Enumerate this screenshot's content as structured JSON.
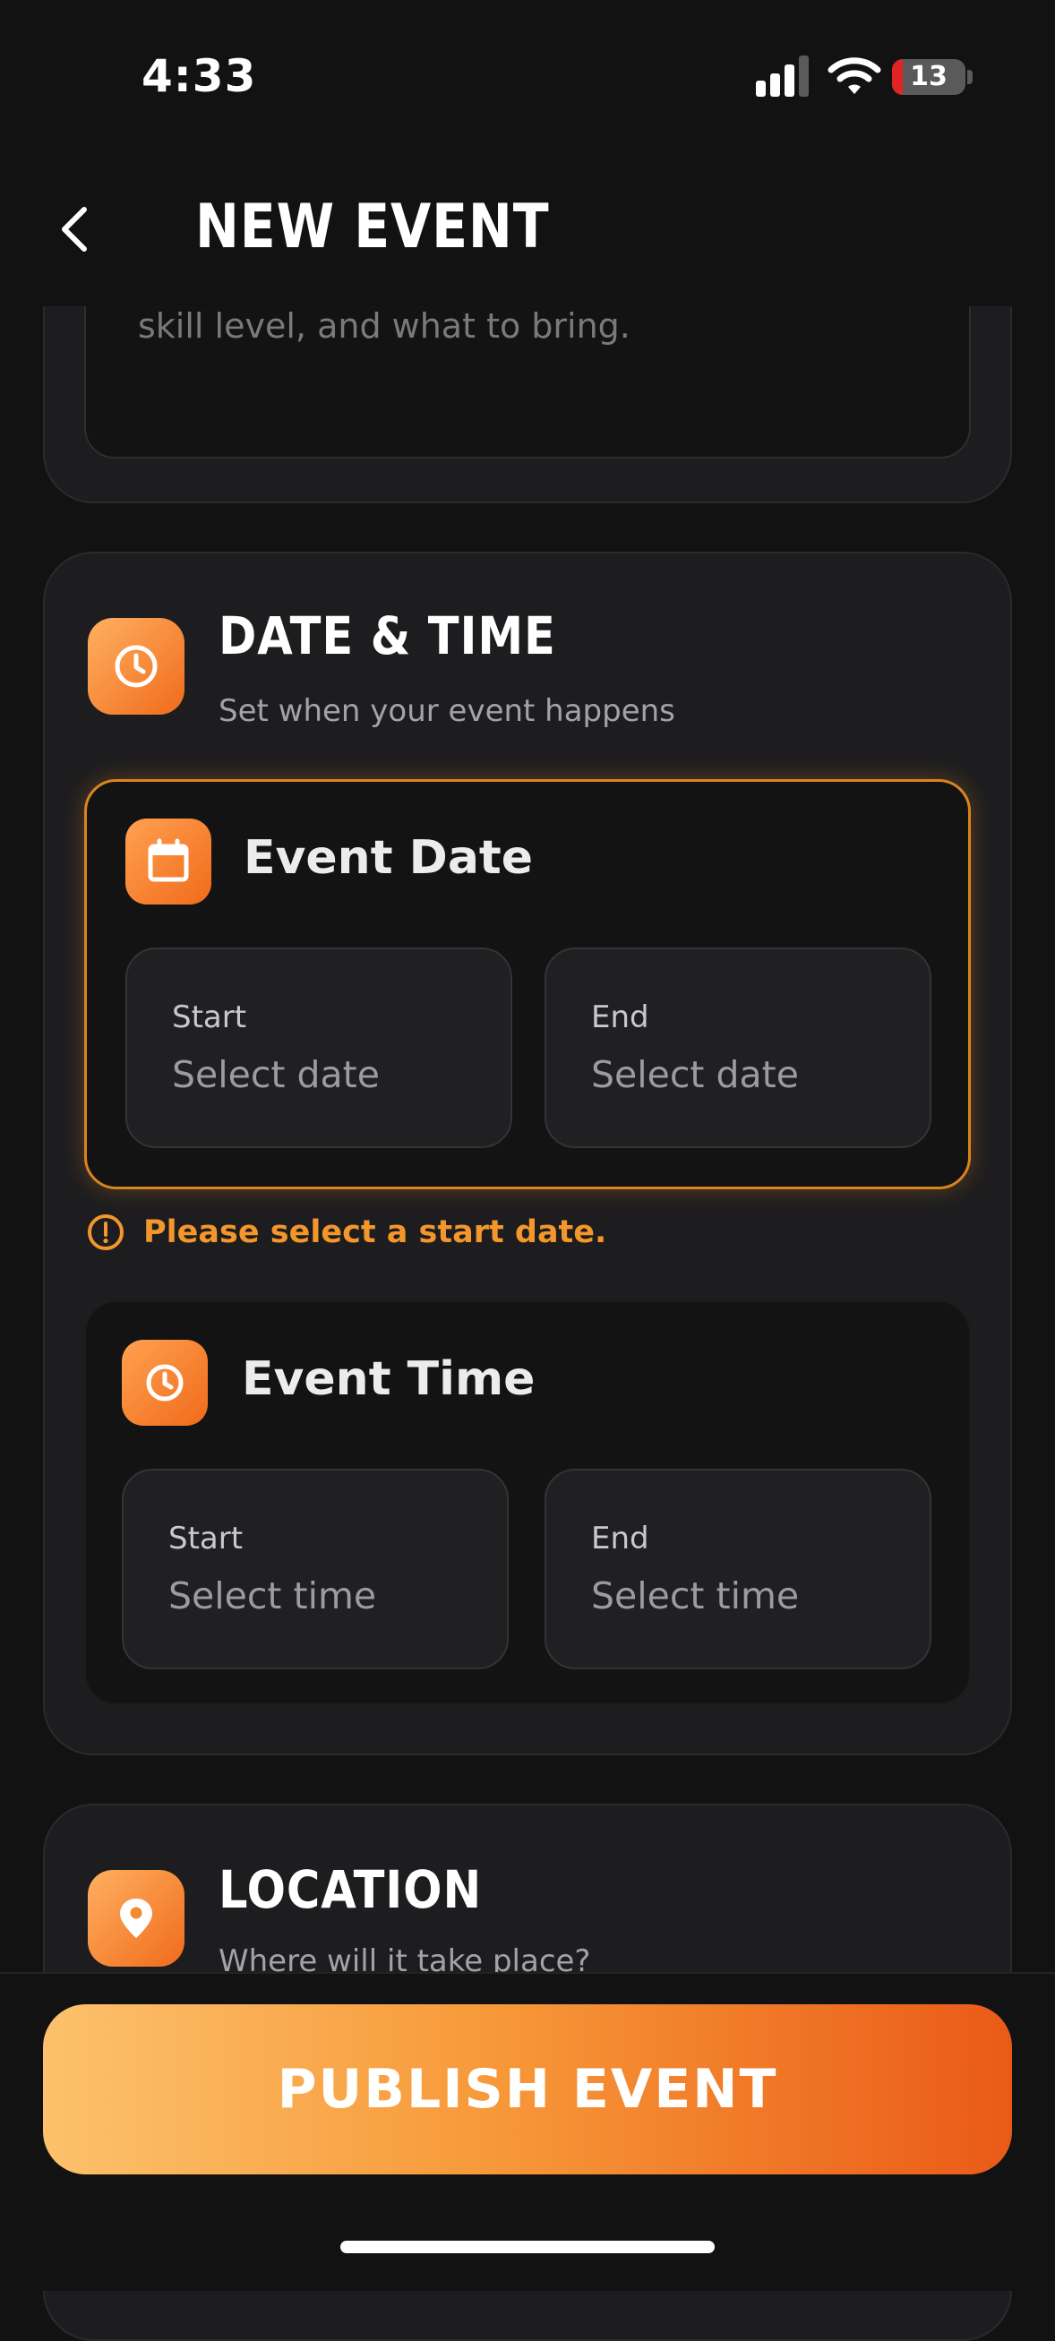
{
  "status_bar": {
    "time": "4:33",
    "battery": "13"
  },
  "header": {
    "title": "NEW EVENT"
  },
  "description": {
    "placeholder_tail": "skill level, and what to bring."
  },
  "date_time": {
    "title": "DATE & TIME",
    "subtitle": "Set when your event happens",
    "event_date": {
      "title": "Event Date",
      "start_label": "Start",
      "start_value": "Select date",
      "end_label": "End",
      "end_value": "Select date"
    },
    "error": "Please select a start date.",
    "event_time": {
      "title": "Event Time",
      "start_label": "Start",
      "start_value": "Select time",
      "end_label": "End",
      "end_value": "Select time"
    }
  },
  "location": {
    "title": "LOCATION",
    "subtitle": "Where will it take place?"
  },
  "actions": {
    "publish_label": "PUBLISH EVENT"
  },
  "colors": {
    "accent": "#f5882a",
    "error": "#f3962b",
    "background": "#121212",
    "card": "#1d1d1f"
  },
  "icons": [
    "back-icon",
    "clock-icon",
    "calendar-icon",
    "alert-icon",
    "location-pin-icon"
  ]
}
